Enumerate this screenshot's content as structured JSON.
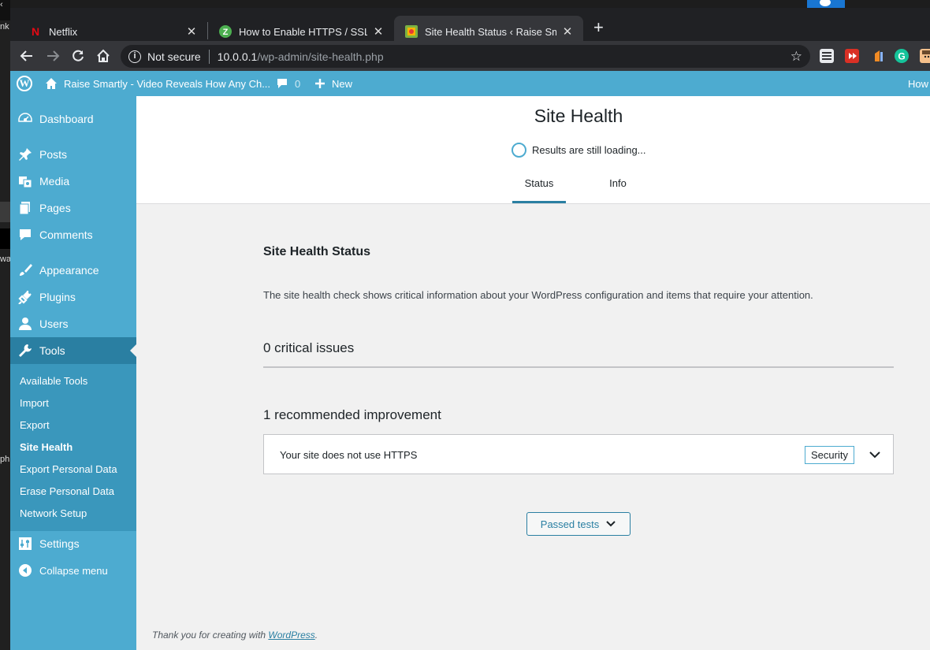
{
  "browser": {
    "tabs": [
      {
        "title": "Netflix",
        "favicon": "netflix-icon",
        "active": false
      },
      {
        "title": "How to Enable HTTPS / SSL on W",
        "favicon": "zapier-icon",
        "active": false
      },
      {
        "title": "Site Health Status ‹ Raise Smartly",
        "favicon": "site-favicon",
        "active": true
      }
    ],
    "address": {
      "security_label": "Not secure",
      "host": "10.0.0.1",
      "path": "/wp-admin/site-health.php"
    }
  },
  "adminbar": {
    "site_name": "Raise Smartly - Video Reveals How Any Ch...",
    "comments_count": "0",
    "new_label": "New",
    "right_label": "How"
  },
  "sidebar": {
    "items": [
      {
        "label": "Dashboard",
        "icon": "dashboard-icon"
      },
      {
        "label": "Posts",
        "icon": "pin-icon"
      },
      {
        "label": "Media",
        "icon": "media-icon"
      },
      {
        "label": "Pages",
        "icon": "pages-icon"
      },
      {
        "label": "Comments",
        "icon": "comment-icon"
      },
      {
        "label": "Appearance",
        "icon": "brush-icon"
      },
      {
        "label": "Plugins",
        "icon": "plug-icon"
      },
      {
        "label": "Users",
        "icon": "user-icon"
      },
      {
        "label": "Tools",
        "icon": "wrench-icon"
      },
      {
        "label": "Settings",
        "icon": "settings-icon"
      },
      {
        "label": "Collapse menu",
        "icon": "collapse-icon"
      }
    ],
    "submenu": [
      "Available Tools",
      "Import",
      "Export",
      "Site Health",
      "Export Personal Data",
      "Erase Personal Data",
      "Network Setup"
    ]
  },
  "main": {
    "title": "Site Health",
    "loading_text": "Results are still loading...",
    "tabs": [
      "Status",
      "Info"
    ],
    "section_title": "Site Health Status",
    "description": "The site health check shows critical information about your WordPress configuration and items that require your attention.",
    "critical_count": "0 critical issues",
    "recommended_count": "1 recommended improvement",
    "issues": [
      {
        "label": "Your site does not use HTTPS",
        "badge": "Security"
      }
    ],
    "passed_label": "Passed tests",
    "footer_text": "Thank you for creating with ",
    "footer_link": "WordPress",
    "footer_end": "."
  },
  "colors": {
    "admin_blue": "#4dabd0",
    "accent_dark": "#2a7fa2",
    "background": "#f1f1f1"
  }
}
